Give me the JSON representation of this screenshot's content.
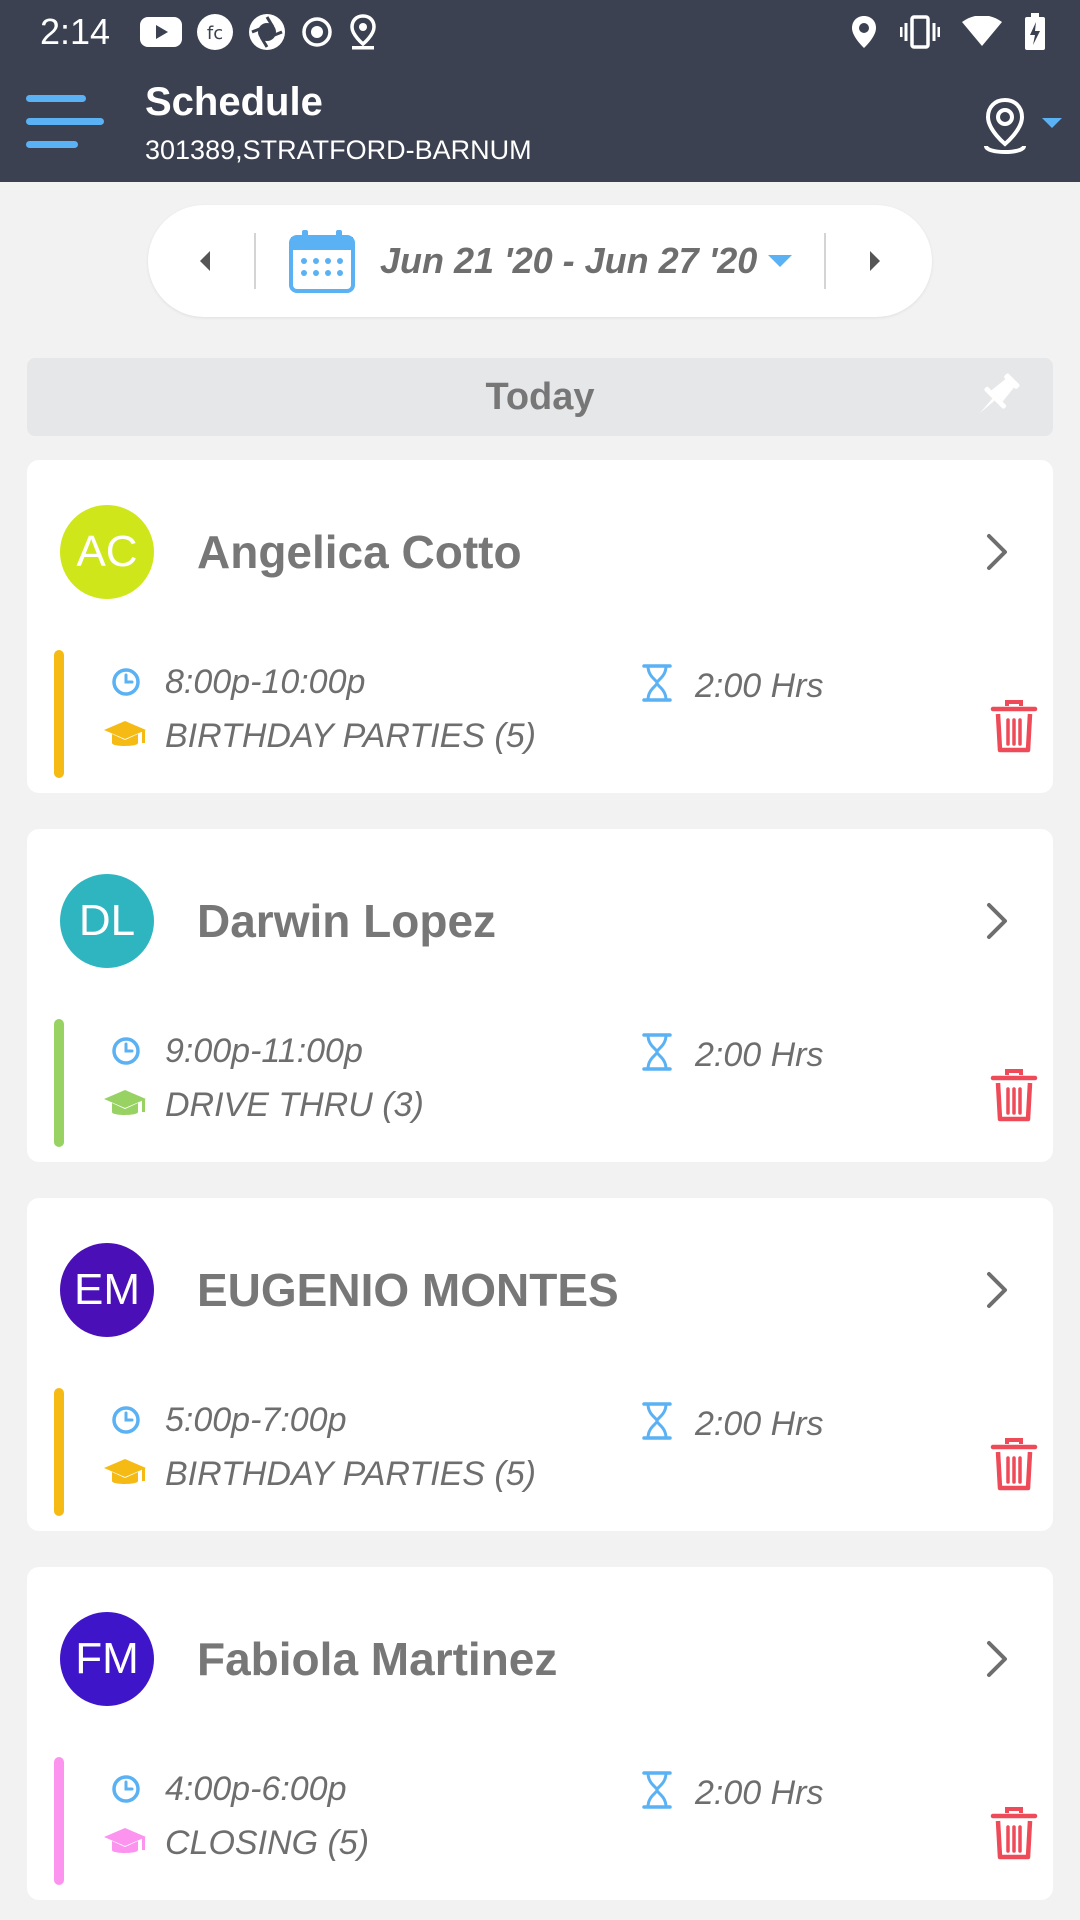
{
  "status_bar": {
    "time": "2:14",
    "left_icons": [
      "youtube-icon",
      "fc-app-icon",
      "camera-app-icon",
      "record-icon",
      "location-pin-icon"
    ],
    "right_icons": [
      "location-icon",
      "vibrate-icon",
      "wifi-icon",
      "battery-charging-icon"
    ]
  },
  "header": {
    "title": "Schedule",
    "subtitle": "301389,STRATFORD-BARNUM",
    "menu_icon": "hamburger-menu-icon",
    "location_icon": "location-pin-icon",
    "accent_color": "#5ab1f3",
    "background_color": "#3b4150"
  },
  "date_nav": {
    "range": "Jun 21 '20 - Jun 27 '20",
    "prev_icon": "caret-left-icon",
    "next_icon": "caret-right-icon",
    "calendar_icon": "calendar-icon",
    "dropdown_icon": "caret-down-icon"
  },
  "section": {
    "label": "Today",
    "pin_icon": "pin-icon"
  },
  "shifts": [
    {
      "initials": "AC",
      "avatar_color": "#cfe61a",
      "name": "Angelica Cotto",
      "time": "8:00p-10:00p",
      "position": "BIRTHDAY PARTIES (5)",
      "position_color": "#f5bb14",
      "duration": "2:00 Hrs"
    },
    {
      "initials": "DL",
      "avatar_color": "#2fb5c0",
      "name": "Darwin Lopez",
      "time": "9:00p-11:00p",
      "position": "DRIVE THRU (3)",
      "position_color": "#97d263",
      "duration": "2:00 Hrs"
    },
    {
      "initials": "EM",
      "avatar_color": "#4a0fb6",
      "name": "EUGENIO MONTES",
      "time": "5:00p-7:00p",
      "position": "BIRTHDAY PARTIES (5)",
      "position_color": "#f5bb14",
      "duration": "2:00 Hrs"
    },
    {
      "initials": "FM",
      "avatar_color": "#3f15c9",
      "name": "Fabiola Martinez",
      "time": "4:00p-6:00p",
      "position": "CLOSING (5)",
      "position_color": "#fb93ef",
      "duration": "2:00 Hrs"
    }
  ],
  "icon_colors": {
    "clock": "#5ab1f3",
    "hourglass": "#5ab1f3",
    "delete": "#ee4a58",
    "chevron": "#6e6e6e"
  }
}
